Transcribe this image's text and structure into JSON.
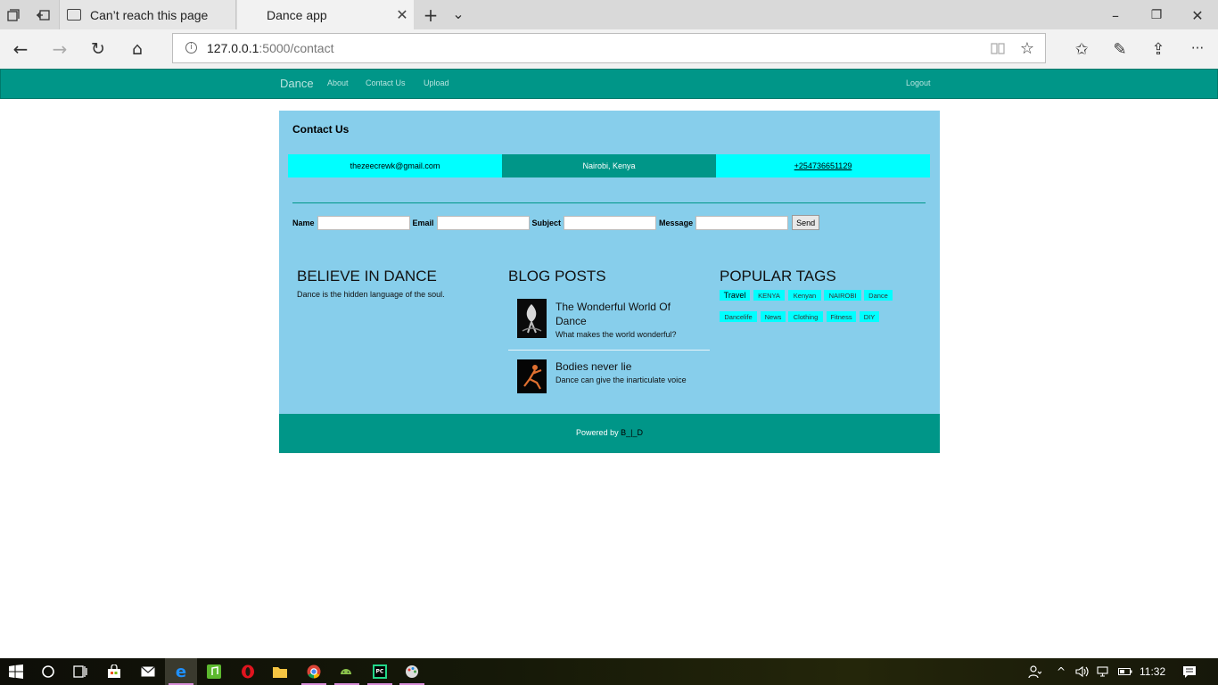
{
  "browser": {
    "tabs": [
      {
        "title": "Can’t reach this page"
      },
      {
        "title": "Dance app"
      }
    ],
    "address": {
      "host": "127.0.0.1",
      "path": ":5000/contact"
    },
    "icons": {
      "set_aside": "set-aside-icon",
      "restore_tabs": "restore-tabs-icon",
      "new_tab": "+",
      "tab_list": "⌄",
      "minimize": "–",
      "maximize": "❐",
      "close": "✕",
      "back": "←",
      "forward": "→",
      "refresh": "↻",
      "home": "⌂",
      "favorite": "☆",
      "favorites_hub": "✩",
      "notes": "✎",
      "share": "⇪",
      "more": "···",
      "reading_view": "📖"
    }
  },
  "nav": {
    "brand": "Dance",
    "links": [
      "About",
      "Contact Us",
      "Upload"
    ],
    "logout": "Logout"
  },
  "contact": {
    "heading": "Contact Us",
    "email": "thezeecrewk@gmail.com",
    "location": "Nairobi, Kenya",
    "phone": "+254736651129"
  },
  "form": {
    "name_label": "Name",
    "email_label": "Email",
    "subject_label": "Subject",
    "message_label": "Message",
    "name_value": "",
    "email_value": "",
    "subject_value": "",
    "message_value": "",
    "send_label": "Send"
  },
  "believe": {
    "title": "BELIEVE IN DANCE",
    "text": "Dance is the hidden language of the soul."
  },
  "blog": {
    "title": "BLOG POSTS",
    "posts": [
      {
        "title": "The Wonderful World Of Dance",
        "desc": "What makes the world wonderful?"
      },
      {
        "title": "Bodies never lie",
        "desc": "Dance can give the inarticulate voice"
      }
    ]
  },
  "tags": {
    "title": "POPULAR TAGS",
    "items": [
      "Travel",
      "KENYA",
      "Kenyan",
      "NAIROBI",
      "Dance",
      "Dancelife",
      "News",
      "Clothing",
      "Fitness",
      "DIY"
    ]
  },
  "footer": {
    "prefix": "Powered by",
    "author": "B_|_D"
  },
  "taskbar": {
    "time": "11:32"
  },
  "colors": {
    "teal": "#009688",
    "sky": "#87ceeb",
    "cyan": "#00ffff"
  }
}
